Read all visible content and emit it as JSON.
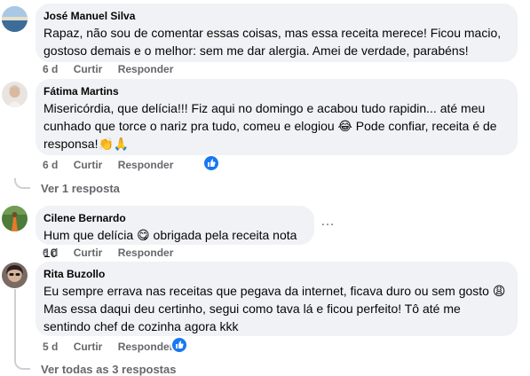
{
  "comments": [
    {
      "author": "José Manuel Silva",
      "text": "Rapaz, não sou de comentar essas coisas, mas essa receita merece! Ficou macio, gostoso demais e o melhor: sem me dar alergia. Amei de verdade, parabéns!",
      "time": "6 d",
      "like_label": "Curtir",
      "reply_label": "Responder"
    },
    {
      "author": "Fátima Martins",
      "text": "Misericórdia, que delícia!!! Fiz aqui no domingo e acabou tudo rapidin... até meu cunhado que torce o nariz pra tudo, comeu e elogiou 😂 Pode confiar, receita é de responsa!👏🙏",
      "time": "6 d",
      "like_label": "Curtir",
      "reply_label": "Responder",
      "reaction_icon": "like-icon",
      "replies_link": "Ver 1 resposta"
    },
    {
      "author": "Cilene Bernardo",
      "text": "Hum que delícia 😋 obrigada pela receita nota 10",
      "time": "6 d",
      "like_label": "Curtir",
      "reply_label": "Responder",
      "more_icon": "…"
    },
    {
      "author": "Rita Buzollo",
      "text": "Eu sempre errava nas receitas que pegava da internet, ficava duro ou sem gosto 😩 Mas essa daqui deu certinho, segui como tava lá e ficou perfeito! Tô até me sentindo chef de cozinha agora kkk",
      "time": "5 d",
      "like_label": "Curtir",
      "reply_label": "Responder",
      "reaction_icon": "like-icon",
      "replies_link": "Ver todas as 3 respostas"
    }
  ],
  "colors": {
    "bubble": "#f0f2f5",
    "meta": "#65676b",
    "like_blue": "#1877f2"
  }
}
